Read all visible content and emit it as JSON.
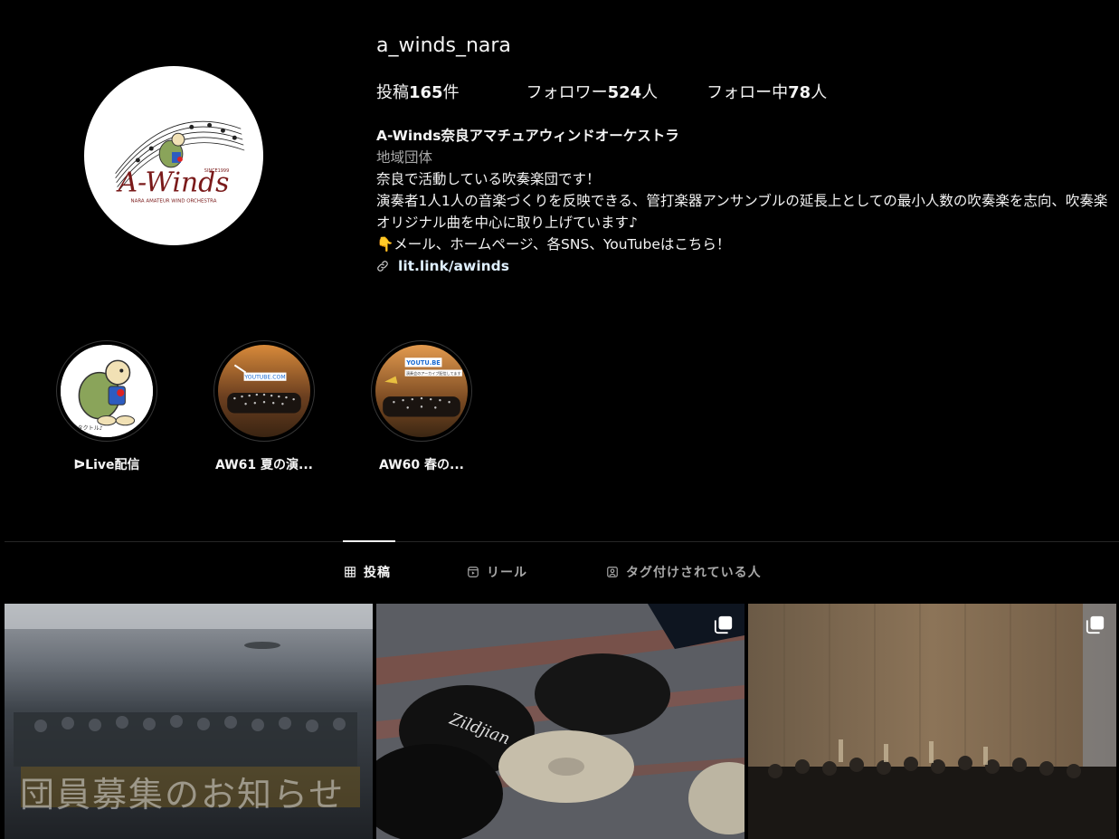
{
  "profile": {
    "username": "a_winds_nara",
    "stats": {
      "posts_label": "投稿",
      "posts_count": "165",
      "posts_unit": "件",
      "followers_label": "フォロワー",
      "followers_count": "524",
      "followers_unit": "人",
      "following_label": "フォロー中",
      "following_count": "78",
      "following_unit": "人"
    },
    "bio": {
      "name": "A-Winds奈良アマチュアウィンドオーケストラ",
      "category": "地域団体",
      "line1": "奈良で活動している吹奏楽団です！",
      "line2": "演奏者1人1人の音楽づくりを反映できる、管打楽器アンサンブルの延長上としての最小人数の吹奏楽を志向、吹奏楽オリジナル曲を中心に取り上げています♪",
      "line3": "👇メール、ホームページ、各SNS、YouTubeはこちら！",
      "link": "lit.link/awinds"
    },
    "avatar": {
      "logo_text": "A-Winds",
      "since": "SINCE1999",
      "subtitle": "NARA AMATEUR WIND ORCHESTRA"
    }
  },
  "highlights": [
    {
      "label": "ᐅLive配信",
      "image_text": "タクトル♪"
    },
    {
      "label": "AW61 夏の演...",
      "image_text": "YOUTUBE.COM"
    },
    {
      "label": "AW60 春の...",
      "image_text": "YOUTU.BE",
      "image_subtext": "演奏会のアーカイブ配信してます"
    }
  ],
  "tabs": [
    {
      "label": "投稿",
      "icon": "grid-icon",
      "active": true
    },
    {
      "label": "リール",
      "icon": "reels-icon",
      "active": false
    },
    {
      "label": "タグ付けされている人",
      "icon": "tagged-icon",
      "active": false
    }
  ],
  "posts": [
    {
      "caption": "団員募集のお知らせ",
      "multi": false
    },
    {
      "caption": "",
      "multi": true,
      "image_text": "Zildjian"
    },
    {
      "caption": "",
      "multi": true
    }
  ],
  "colors": {
    "background": "#000000",
    "text_primary": "#f5f5f5",
    "text_secondary": "#a8a8a8",
    "link": "#e0f1ff",
    "divider": "#262626"
  }
}
